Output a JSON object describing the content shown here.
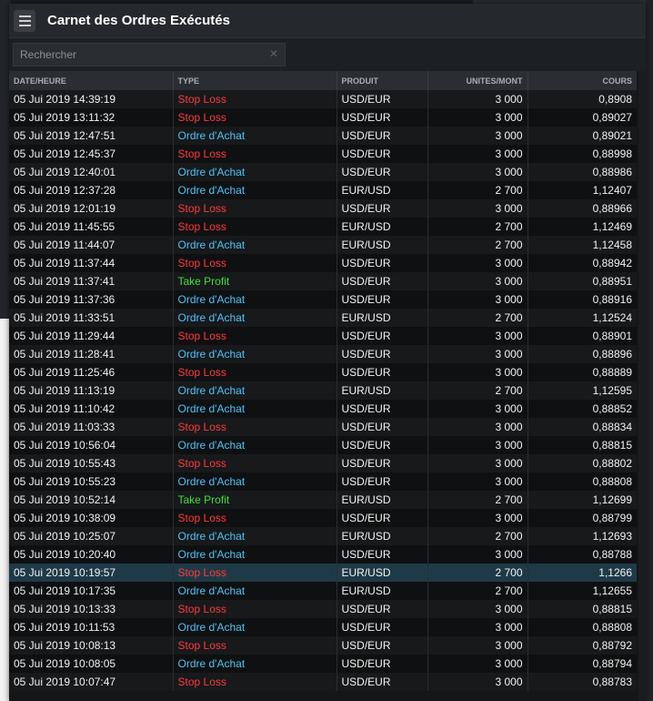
{
  "panel": {
    "title": "Carnet des Ordres Exécutés"
  },
  "search": {
    "placeholder": "Rechercher",
    "value": ""
  },
  "columns": [
    "DATE/HEURE",
    "TYPE",
    "PRODUIT",
    "UNITES/MONT",
    "COURS"
  ],
  "type_colors": {
    "Stop Loss": "#ff3b3b",
    "Ordre d'Achat": "#4fc3f7",
    "Take Profit": "#3ee03e"
  },
  "rows": [
    {
      "date": "05 Jui 2019 14:39:19",
      "type": "Stop Loss",
      "product": "USD/EUR",
      "units": "3 000",
      "rate": "0,8908"
    },
    {
      "date": "05 Jui 2019 13:11:32",
      "type": "Stop Loss",
      "product": "USD/EUR",
      "units": "3 000",
      "rate": "0,89027"
    },
    {
      "date": "05 Jui 2019 12:47:51",
      "type": "Ordre d'Achat",
      "product": "USD/EUR",
      "units": "3 000",
      "rate": "0,89021"
    },
    {
      "date": "05 Jui 2019 12:45:37",
      "type": "Stop Loss",
      "product": "USD/EUR",
      "units": "3 000",
      "rate": "0,88998"
    },
    {
      "date": "05 Jui 2019 12:40:01",
      "type": "Ordre d'Achat",
      "product": "USD/EUR",
      "units": "3 000",
      "rate": "0,88986"
    },
    {
      "date": "05 Jui 2019 12:37:28",
      "type": "Ordre d'Achat",
      "product": "EUR/USD",
      "units": "2 700",
      "rate": "1,12407"
    },
    {
      "date": "05 Jui 2019 12:01:19",
      "type": "Stop Loss",
      "product": "USD/EUR",
      "units": "3 000",
      "rate": "0,88966"
    },
    {
      "date": "05 Jui 2019 11:45:55",
      "type": "Stop Loss",
      "product": "EUR/USD",
      "units": "2 700",
      "rate": "1,12469"
    },
    {
      "date": "05 Jui 2019 11:44:07",
      "type": "Ordre d'Achat",
      "product": "EUR/USD",
      "units": "2 700",
      "rate": "1,12458"
    },
    {
      "date": "05 Jui 2019 11:37:44",
      "type": "Stop Loss",
      "product": "USD/EUR",
      "units": "3 000",
      "rate": "0,88942"
    },
    {
      "date": "05 Jui 2019 11:37:41",
      "type": "Take Profit",
      "product": "USD/EUR",
      "units": "3 000",
      "rate": "0,88951"
    },
    {
      "date": "05 Jui 2019 11:37:36",
      "type": "Ordre d'Achat",
      "product": "USD/EUR",
      "units": "3 000",
      "rate": "0,88916"
    },
    {
      "date": "05 Jui 2019 11:33:51",
      "type": "Ordre d'Achat",
      "product": "EUR/USD",
      "units": "2 700",
      "rate": "1,12524"
    },
    {
      "date": "05 Jui 2019 11:29:44",
      "type": "Stop Loss",
      "product": "USD/EUR",
      "units": "3 000",
      "rate": "0,88901"
    },
    {
      "date": "05 Jui 2019 11:28:41",
      "type": "Ordre d'Achat",
      "product": "USD/EUR",
      "units": "3 000",
      "rate": "0,88896"
    },
    {
      "date": "05 Jui 2019 11:25:46",
      "type": "Stop Loss",
      "product": "USD/EUR",
      "units": "3 000",
      "rate": "0,88889"
    },
    {
      "date": "05 Jui 2019 11:13:19",
      "type": "Ordre d'Achat",
      "product": "EUR/USD",
      "units": "2 700",
      "rate": "1,12595"
    },
    {
      "date": "05 Jui 2019 11:10:42",
      "type": "Ordre d'Achat",
      "product": "USD/EUR",
      "units": "3 000",
      "rate": "0,88852"
    },
    {
      "date": "05 Jui 2019 11:03:33",
      "type": "Stop Loss",
      "product": "USD/EUR",
      "units": "3 000",
      "rate": "0,88834"
    },
    {
      "date": "05 Jui 2019 10:56:04",
      "type": "Ordre d'Achat",
      "product": "USD/EUR",
      "units": "3 000",
      "rate": "0,88815"
    },
    {
      "date": "05 Jui 2019 10:55:43",
      "type": "Stop Loss",
      "product": "USD/EUR",
      "units": "3 000",
      "rate": "0,88802"
    },
    {
      "date": "05 Jui 2019 10:55:23",
      "type": "Ordre d'Achat",
      "product": "USD/EUR",
      "units": "3 000",
      "rate": "0,88808"
    },
    {
      "date": "05 Jui 2019 10:52:14",
      "type": "Take Profit",
      "product": "EUR/USD",
      "units": "2 700",
      "rate": "1,12699"
    },
    {
      "date": "05 Jui 2019 10:38:09",
      "type": "Stop Loss",
      "product": "USD/EUR",
      "units": "3 000",
      "rate": "0,88799"
    },
    {
      "date": "05 Jui 2019 10:25:07",
      "type": "Ordre d'Achat",
      "product": "EUR/USD",
      "units": "2 700",
      "rate": "1,12693"
    },
    {
      "date": "05 Jui 2019 10:20:40",
      "type": "Ordre d'Achat",
      "product": "USD/EUR",
      "units": "3 000",
      "rate": "0,88788"
    },
    {
      "date": "05 Jui 2019 10:19:57",
      "type": "Stop Loss",
      "product": "EUR/USD",
      "units": "2 700",
      "rate": "1,1266",
      "selected": true
    },
    {
      "date": "05 Jui 2019 10:17:35",
      "type": "Ordre d'Achat",
      "product": "EUR/USD",
      "units": "2 700",
      "rate": "1,12655"
    },
    {
      "date": "05 Jui 2019 10:13:33",
      "type": "Stop Loss",
      "product": "USD/EUR",
      "units": "3 000",
      "rate": "0,88815"
    },
    {
      "date": "05 Jui 2019 10:11:53",
      "type": "Ordre d'Achat",
      "product": "USD/EUR",
      "units": "3 000",
      "rate": "0,88808"
    },
    {
      "date": "05 Jui 2019 10:08:13",
      "type": "Stop Loss",
      "product": "USD/EUR",
      "units": "3 000",
      "rate": "0,88792"
    },
    {
      "date": "05 Jui 2019 10:08:05",
      "type": "Ordre d'Achat",
      "product": "USD/EUR",
      "units": "3 000",
      "rate": "0,88794"
    },
    {
      "date": "05 Jui 2019 10:07:47",
      "type": "Stop Loss",
      "product": "USD/EUR",
      "units": "3 000",
      "rate": "0,88783"
    }
  ]
}
